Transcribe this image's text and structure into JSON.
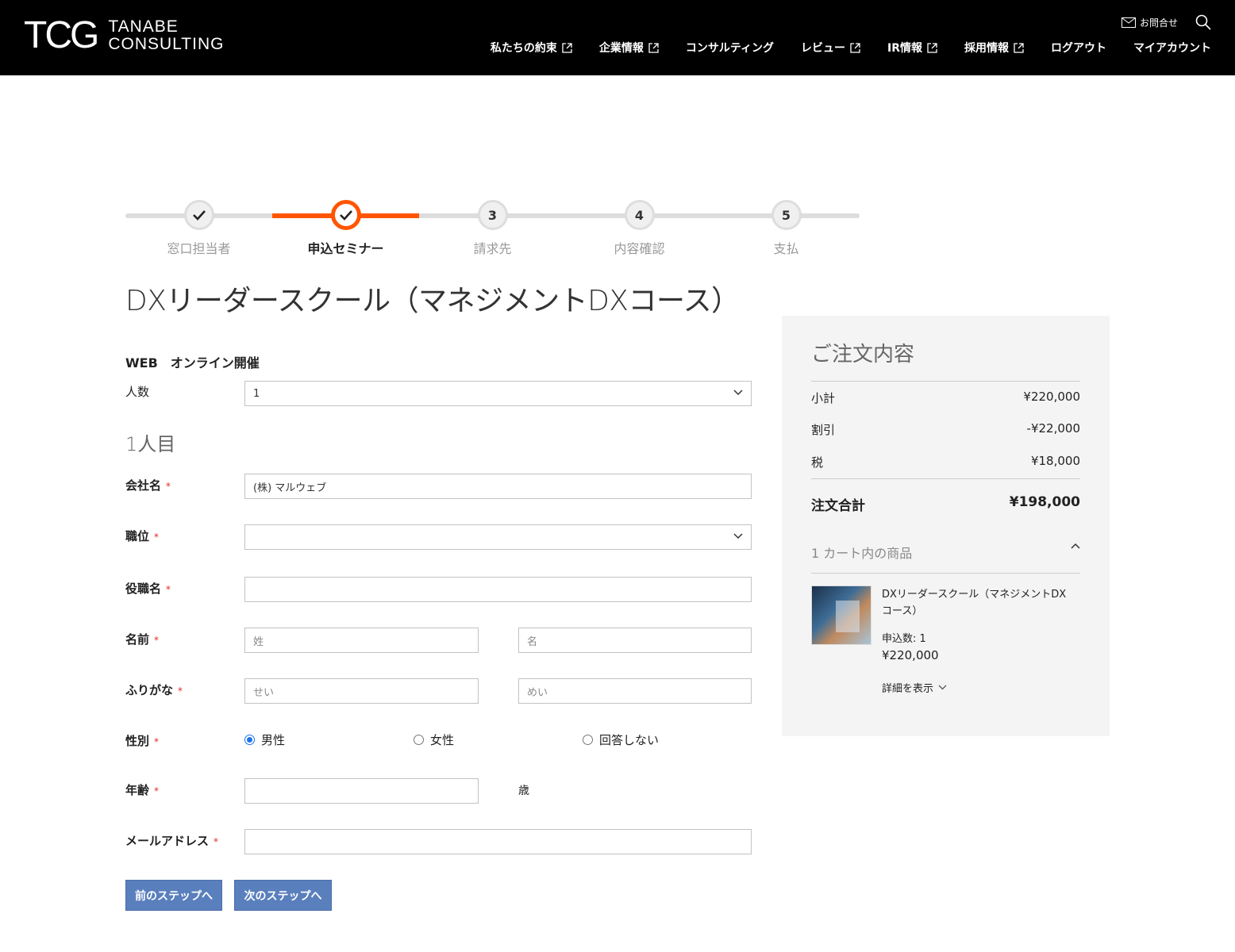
{
  "header": {
    "logo_mark": "TCG",
    "logo_line1": "TANABE",
    "logo_line2": "CONSULTING",
    "contact": "お問合せ",
    "nav": [
      "私たちの約束",
      "企業情報",
      "コンサルティング",
      "レビュー",
      "IR情報",
      "採用情報",
      "ログアウト",
      "マイアカウント"
    ]
  },
  "steps": [
    {
      "num": "",
      "label": "窓口担当者",
      "state": "done"
    },
    {
      "num": "",
      "label": "申込セミナー",
      "state": "active"
    },
    {
      "num": "3",
      "label": "請求先",
      "state": "todo"
    },
    {
      "num": "4",
      "label": "内容確認",
      "state": "todo"
    },
    {
      "num": "5",
      "label": "支払",
      "state": "todo"
    }
  ],
  "page_title": "DXリーダースクール（マネジメントDXコース）",
  "form": {
    "event_title": "WEB　オンライン開催",
    "count_label": "人数",
    "count_value": "1",
    "person_heading": "1人目",
    "company_label": "会社名",
    "company_value": "(株) マルウェブ",
    "position_label": "職位",
    "title_label": "役職名",
    "name_label": "名前",
    "last_name_ph": "姓",
    "first_name_ph": "名",
    "kana_label": "ふりがな",
    "last_kana_ph": "せい",
    "first_kana_ph": "めい",
    "gender_label": "性別",
    "gender_options": [
      "男性",
      "女性",
      "回答しない"
    ],
    "age_label": "年齢",
    "age_unit": "歳",
    "email_label": "メールアドレス",
    "required_mark": "*",
    "prev_button": "前のステップへ",
    "next_button": "次のステップへ"
  },
  "summary": {
    "title": "ご注文内容",
    "subtotal_label": "小計",
    "subtotal": "¥220,000",
    "discount_label": "割引",
    "discount": "-¥22,000",
    "tax_label": "税",
    "tax": "¥18,000",
    "total_label": "注文合計",
    "total": "¥198,000",
    "cart_label": "1 カート内の商品",
    "product_name": "DXリーダースクール（マネジメントDXコース）",
    "product_qty": "申込数: 1",
    "product_price": "¥220,000",
    "details_link": "詳細を表示"
  },
  "colors": {
    "accent": "#ff5501",
    "button": "#5a7fbd",
    "header_bg": "#000000"
  }
}
